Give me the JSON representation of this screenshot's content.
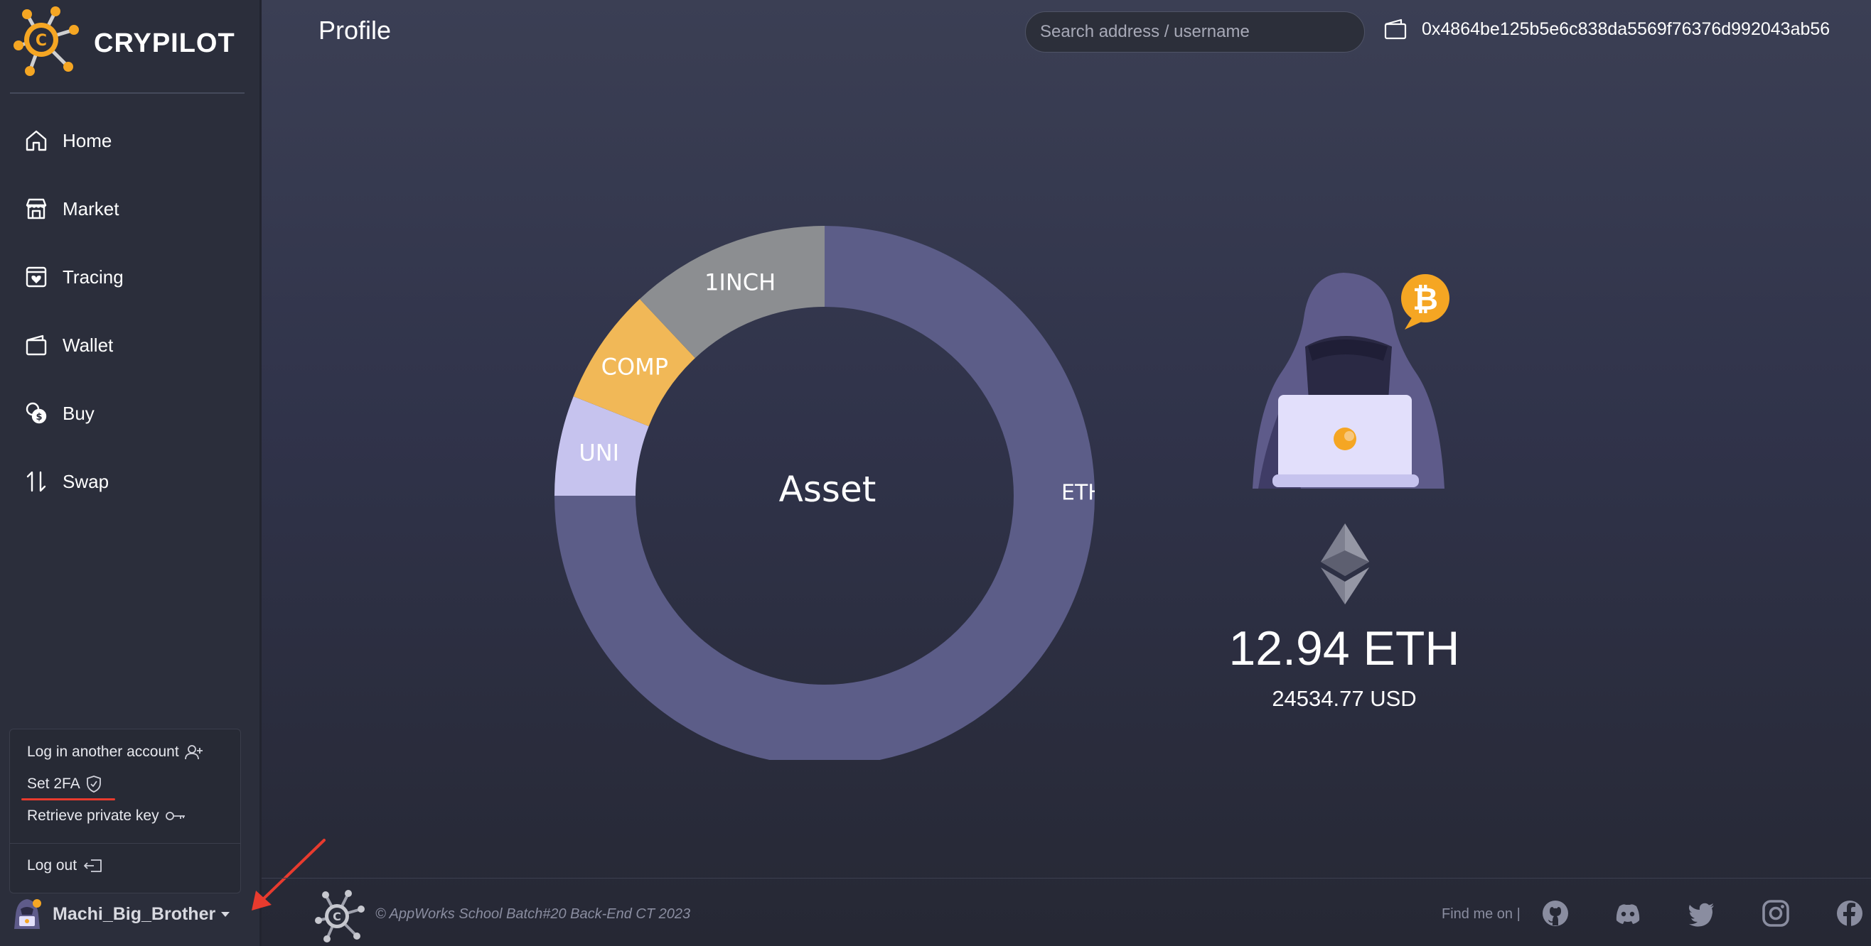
{
  "app": {
    "name": "CRYPILOT",
    "page_title": "Profile"
  },
  "search": {
    "placeholder": "Search address / username"
  },
  "wallet": {
    "address": "0x4864be125b5e6c838da5569f76376d992043ab56"
  },
  "sidebar": {
    "items": [
      {
        "label": "Home",
        "icon": "home-icon"
      },
      {
        "label": "Market",
        "icon": "market-icon"
      },
      {
        "label": "Tracing",
        "icon": "tracing-icon"
      },
      {
        "label": "Wallet",
        "icon": "wallet-icon"
      },
      {
        "label": "Buy",
        "icon": "buy-icon"
      },
      {
        "label": "Swap",
        "icon": "swap-icon"
      }
    ]
  },
  "account_menu": {
    "items": [
      {
        "label": "Log in another account",
        "icon": "add-user-icon"
      },
      {
        "label": "Set 2FA",
        "icon": "shield-check-icon"
      },
      {
        "label": "Retrieve private key",
        "icon": "key-icon"
      },
      {
        "label": "Log out",
        "icon": "logout-icon"
      }
    ]
  },
  "user": {
    "name": "Machi_Big_Brother"
  },
  "chart_data": {
    "type": "pie",
    "title": "Asset",
    "donut": true,
    "slices": [
      {
        "label": "ETH",
        "value": 75,
        "color": "#5c5d88"
      },
      {
        "label": "UNI",
        "value": 6,
        "color": "#c6c3ee"
      },
      {
        "label": "COMP",
        "value": 7,
        "color": "#f1b857"
      },
      {
        "label": "1INCH",
        "value": 12,
        "color": "#8c8e91"
      }
    ]
  },
  "balance": {
    "eth": "12.94 ETH",
    "usd": "24534.77 USD"
  },
  "footer": {
    "copyright": "© AppWorks School Batch#20 Back-End CT 2023",
    "find_me": "Find me on |",
    "social": [
      "github-icon",
      "discord-icon",
      "twitter-icon",
      "instagram-icon",
      "facebook-icon"
    ]
  },
  "colors": {
    "accent_orange": "#f5a623",
    "annotation_red": "#e83b2e",
    "hood": "#5e5b8a"
  }
}
